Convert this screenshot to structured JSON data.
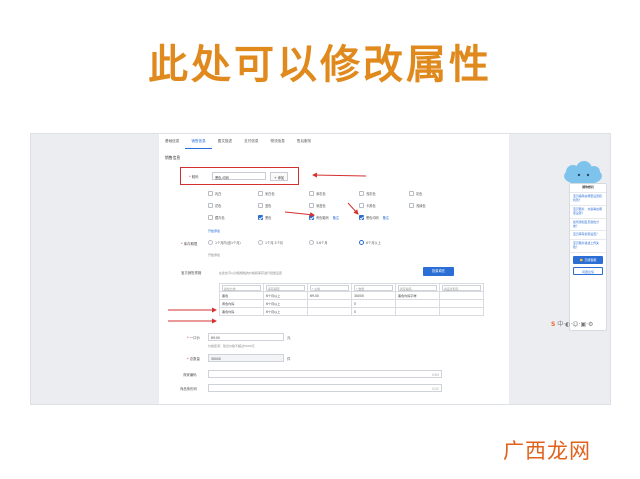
{
  "slide": {
    "title": "此处可以修改属性"
  },
  "tabs": [
    "基础信息",
    "销售信息",
    "图文描述",
    "支付信息",
    "物流信息",
    "售后服务"
  ],
  "section_title": "销售信息",
  "attr": {
    "required": "*",
    "label": "鞋码",
    "select": "颜色分类",
    "value": "黑色,均码",
    "add_button": "+ 添加"
  },
  "color_options": [
    {
      "label": "乳白",
      "checked": false
    },
    {
      "label": "米白色",
      "checked": false
    },
    {
      "label": "深灰色",
      "checked": false
    },
    {
      "label": "浅灰色",
      "checked": false
    },
    {
      "label": "灰色",
      "checked": false
    },
    {
      "label": "花色",
      "checked": false
    },
    {
      "label": "蓝色",
      "checked": false
    },
    {
      "label": "深蓝色",
      "checked": false
    },
    {
      "label": "卡其色",
      "checked": false
    },
    {
      "label": "浅绿色",
      "checked": false
    },
    {
      "label": "藏青色",
      "checked": false
    },
    {
      "label": "黑色",
      "checked": true
    },
    {
      "label": "黄色鞋码",
      "checked": true,
      "edit": "备注"
    },
    {
      "label": "黑色均码",
      "checked": true,
      "edit": "备注"
    }
  ],
  "custom_link": "开始添加",
  "stock": {
    "required": "*",
    "label": "库存期限",
    "hint": "开始添加",
    "options": [
      {
        "label": "1个月内(含1个月)",
        "on": false
      },
      {
        "label": "1个月-3个月",
        "on": false
      },
      {
        "label": "3-6个月",
        "on": false
      },
      {
        "label": "6个月以上",
        "on": true
      }
    ]
  },
  "batch": {
    "label": "宝贝销售规格",
    "hint": "在此处可以对各规格的价格和库存进行批量设置",
    "button": "批量填充"
  },
  "batch_inputs": [
    "颜色分类",
    "库存期限",
    "* 价格",
    "* 数量",
    "商家编码",
    "商品条形码"
  ],
  "table_rows": [
    [
      "黑色",
      "6个月以上",
      "69.00",
      "30000",
      "黑色均码字样"
    ],
    [
      "黄色均码",
      "6个月以上",
      "",
      "0",
      ""
    ],
    [
      "黑色均码",
      "6个月以上",
      "",
      "0",
      ""
    ]
  ],
  "price": {
    "required": "*",
    "label": "一口价",
    "value": "69.00",
    "unit": "元",
    "hint": "价格区间：建议价格不超过5000元"
  },
  "qty": {
    "required": "*",
    "label": "总数量",
    "value": "30000",
    "unit": "件"
  },
  "merchant_code": {
    "label": "商家编码",
    "counter": "0/64"
  },
  "barcode": {
    "label": "商品条形码",
    "counter": "0/32"
  },
  "chat": {
    "title": "猜你想问",
    "questions": [
      "宝贝编码在哪里设置和找到？",
      "宝贝图片、文案等在哪里设置？",
      "如何添加宝贝颜色分类？",
      "宝贝库存如何设置？",
      "宝贝图片描述上传失败？"
    ],
    "button": "万能客服",
    "button2": "问题反馈"
  },
  "toolbar": {
    "logo": "S",
    "icons": "中·◐·☺·▣·⚙"
  },
  "watermark": "广西龙网",
  "colors": {
    "accent": "#2a6ed6",
    "title": "#e08a1e",
    "alert": "#d53030",
    "watermark": "#e0611c"
  }
}
